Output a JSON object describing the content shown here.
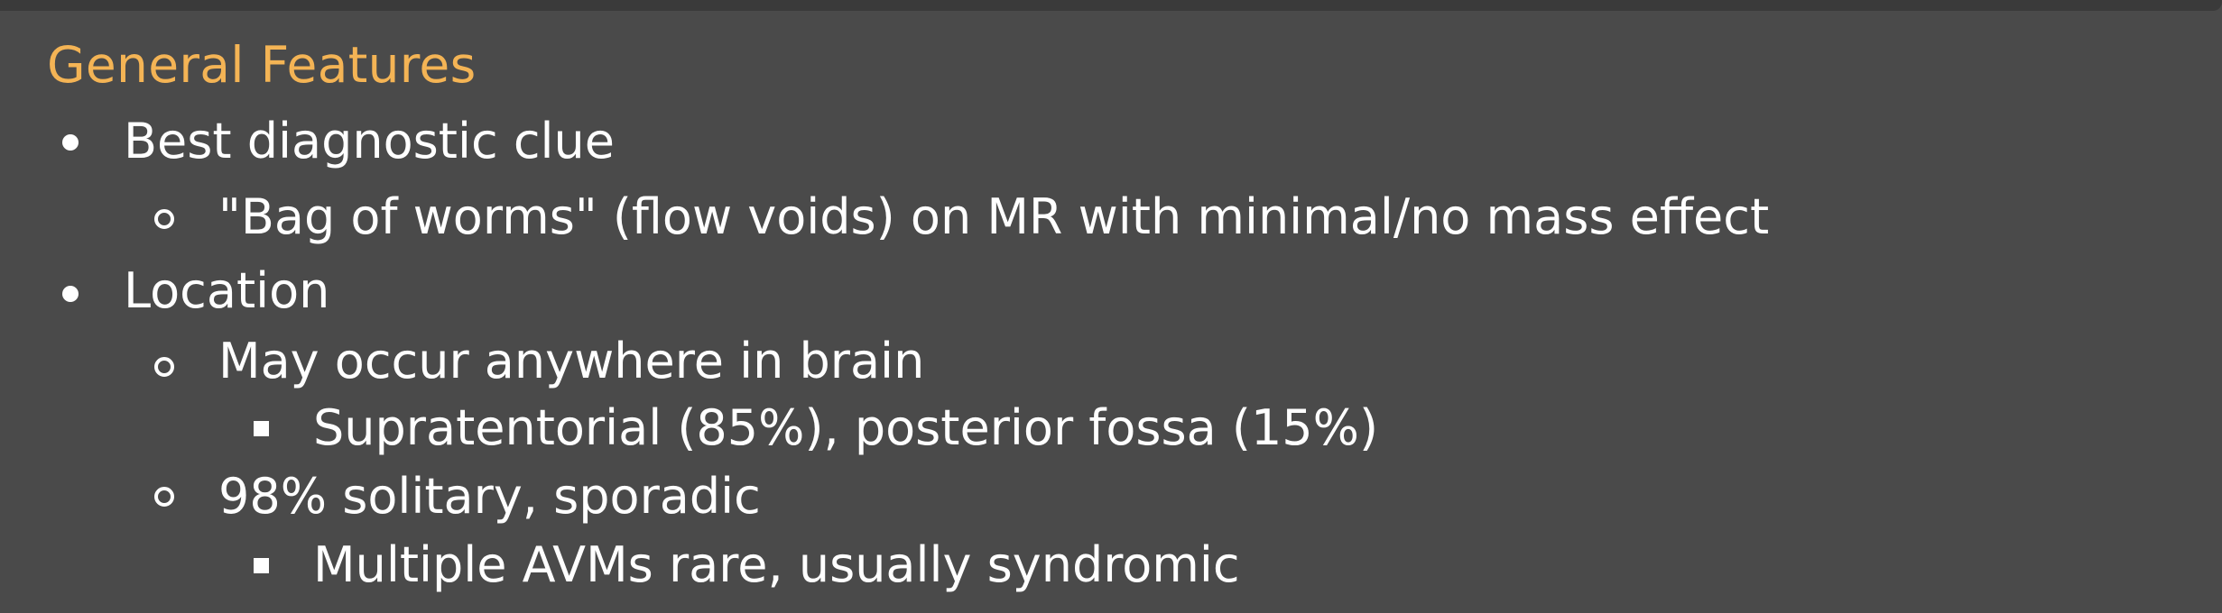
{
  "title": "General Features",
  "items": [
    {
      "text": "Best diagnostic clue",
      "children": [
        {
          "text": "\"Bag of worms\" (flow voids) on MR with minimal/no mass effect",
          "children": []
        }
      ]
    },
    {
      "text": "Location",
      "children": [
        {
          "text": "May occur anywhere in brain",
          "children": [
            {
              "text": "Supratentorial (85%), posterior fossa (15%)"
            }
          ]
        },
        {
          "text": "98% solitary, sporadic",
          "children": [
            {
              "text": "Multiple AVMs rare, usually syndromic"
            }
          ]
        }
      ]
    }
  ]
}
